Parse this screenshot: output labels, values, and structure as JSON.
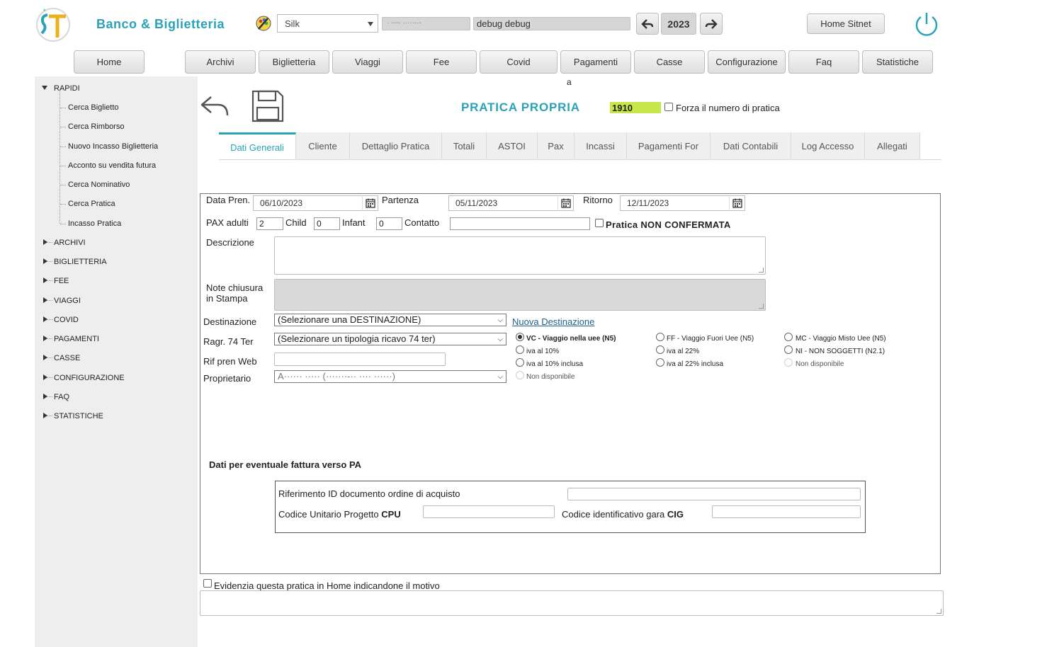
{
  "header": {
    "app_title": "Banco & Biglietteria",
    "theme_value": "Silk",
    "user_value": "· ---- ·····-·-",
    "debug_value": "debug debug",
    "year": "2023",
    "home_sitnet": "Home Sitnet",
    "brand_color": "#2aa3b9"
  },
  "nav": {
    "items": [
      "Home",
      "Archivi",
      "Biglietteria",
      "Viaggi",
      "Fee",
      "Covid",
      "Pagamenti",
      "Casse",
      "Configurazione",
      "Faq",
      "Statistiche"
    ],
    "sub_label": "a"
  },
  "sidebar": {
    "rapidi": "RAPIDI",
    "rapidi_items": [
      "Cerca Biglietto",
      "Cerca Rimborso",
      "Nuovo Incasso Biglietteria",
      "Acconto su vendita futura",
      "Cerca Nominativo",
      "Cerca Pratica",
      "Incasso Pratica"
    ],
    "groups": [
      "ARCHIVI",
      "BIGLIETTERIA",
      "FEE",
      "VIAGGI",
      "COVID",
      "PAGAMENTI",
      "CASSE",
      "CONFIGURAZIONE",
      "FAQ",
      "STATISTICHE"
    ]
  },
  "page": {
    "title": "PRATICA PROPRIA",
    "pratica_number": "1910",
    "forza_label": "Forza il numero di pratica"
  },
  "tabs": [
    "Dati Generali",
    "Cliente",
    "Dettaglio Pratica",
    "Totali",
    "ASTOI",
    "Pax",
    "Incassi",
    "Pagamenti For",
    "Dati Contabili",
    "Log Accesso",
    "Allegati"
  ],
  "form": {
    "data_pren_label": "Data Pren.",
    "data_pren_value": "06/10/2023",
    "partenza_label": "Partenza",
    "partenza_value": "05/11/2023",
    "ritorno_label": "Ritorno",
    "ritorno_value": "12/11/2023",
    "pax_adulti_label": "PAX adulti",
    "pax_adulti_value": "2",
    "child_label": "Child",
    "child_value": "0",
    "infant_label": "Infant",
    "infant_value": "0",
    "contatto_label": "Contatto",
    "non_confermata_label": "Pratica NON CONFERMATA",
    "descrizione_label": "Descrizione",
    "note_label_1": "Note chiusura",
    "note_label_2": "in Stampa",
    "destinazione_label": "Destinazione",
    "destinazione_value": "(Selezionare una DESTINAZIONE)",
    "nuova_destinazione": "Nuova Destinazione",
    "ragr_label": "Ragr. 74 Ter",
    "ragr_value": "(Selezionare un tipologia ricavo 74 ter)",
    "rif_pren_label": "Rif pren Web",
    "proprietario_label": "Proprietario",
    "proprietario_value": "A······ ····· (·······-·· ···· ······)",
    "radios": {
      "vc": "VC - Viaggio nella uee (N5)",
      "vc_10": "iva al 10%",
      "vc_10_incl": "iva al 10% inclusa",
      "vc_nd": "Non disponibile",
      "ff": "FF - Viaggio Fuori Uee (N5)",
      "ff_22": "iva al 22%",
      "ff_22_incl": "iva al 22% inclusa",
      "mc": "MC - Viaggio Misto Uee (N5)",
      "ni": "NI - NON SOGGETTI (N2.1)",
      "mc_nd": "Non disponibile"
    },
    "pa_heading": "Dati per eventuale fattura verso PA",
    "pa_rif_label": "Riferimento ID documento ordine di acquisto",
    "pa_cup_label": "Codice Unitario Progetto",
    "pa_cup_bold": "CPU",
    "pa_cig_label": "Codice identificativo gara",
    "pa_cig_bold": "CIG",
    "evidenzia_label": "Evidenzia questa pratica in Home indicandone il motivo"
  }
}
